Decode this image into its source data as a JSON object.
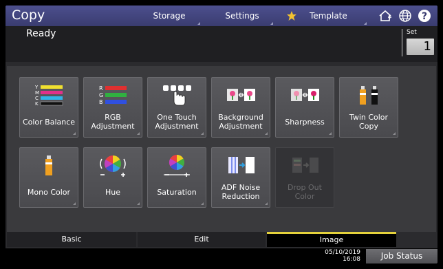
{
  "header": {
    "title": "Copy",
    "nav": [
      {
        "label": "Storage"
      },
      {
        "label": "Settings"
      },
      {
        "label": "Template"
      }
    ],
    "icons": [
      "home-icon",
      "globe-icon",
      "help-icon"
    ]
  },
  "status": {
    "text": "Ready",
    "set_label": "Set",
    "set_value": "1"
  },
  "tiles": [
    {
      "label": "Color Balance",
      "icon": "color-balance-icon",
      "enabled": true
    },
    {
      "label": "RGB Adjustment",
      "icon": "rgb-adjustment-icon",
      "enabled": true
    },
    {
      "label": "One Touch Adjustment",
      "icon": "one-touch-icon",
      "enabled": true
    },
    {
      "label": "Background Adjustment",
      "icon": "background-adjustment-icon",
      "enabled": true
    },
    {
      "label": "Sharpness",
      "icon": "sharpness-icon",
      "enabled": true
    },
    {
      "label": "Twin Color Copy",
      "icon": "twin-color-icon",
      "enabled": true
    },
    {
      "label": "Mono Color",
      "icon": "mono-color-icon",
      "enabled": true
    },
    {
      "label": "Hue",
      "icon": "hue-icon",
      "enabled": true
    },
    {
      "label": "Saturation",
      "icon": "saturation-icon",
      "enabled": true
    },
    {
      "label": "ADF Noise Reduction",
      "icon": "adf-noise-icon",
      "enabled": true
    },
    {
      "label": "Drop Out Color",
      "icon": "drop-out-color-icon",
      "enabled": false
    }
  ],
  "tabs": [
    {
      "label": "Basic",
      "active": false
    },
    {
      "label": "Edit",
      "active": false
    },
    {
      "label": "Image",
      "active": true
    }
  ],
  "footer": {
    "date": "05/10/2019",
    "time": "16:08",
    "job_status": "Job Status"
  },
  "colors": {
    "header": "#4c4f8e",
    "active_tab_indicator": "#e5d23c",
    "panel": "#3a3a3d"
  }
}
